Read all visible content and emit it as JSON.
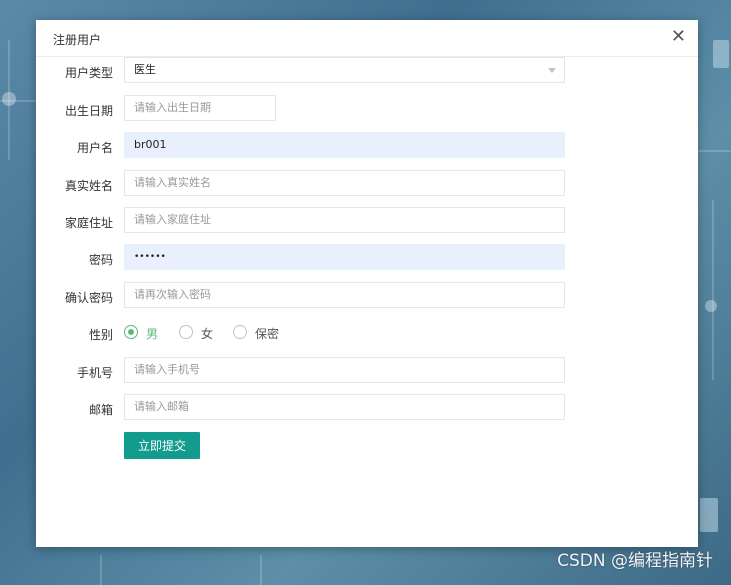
{
  "dialog": {
    "title": "注册用户",
    "close_glyph": "✕"
  },
  "form": {
    "user_type": {
      "label": "用户类型",
      "value": "医生"
    },
    "birth_date": {
      "label": "出生日期",
      "placeholder": "请输入出生日期"
    },
    "username": {
      "label": "用户名",
      "value": "br001"
    },
    "real_name": {
      "label": "真实姓名",
      "placeholder": "请输入真实姓名"
    },
    "address": {
      "label": "家庭住址",
      "placeholder": "请输入家庭住址"
    },
    "password": {
      "label": "密码",
      "value": "••••••"
    },
    "confirm_password": {
      "label": "确认密码",
      "placeholder": "请再次输入密码"
    },
    "gender": {
      "label": "性别",
      "options": [
        "男",
        "女",
        "保密"
      ],
      "selected": "男"
    },
    "phone": {
      "label": "手机号",
      "placeholder": "请输入手机号"
    },
    "email": {
      "label": "邮箱",
      "placeholder": "请输入邮箱"
    },
    "submit_label": "立即提交"
  },
  "watermark": "CSDN @编程指南针",
  "colors": {
    "accent": "#129c8e",
    "radio_checked": "#5fb878",
    "autofill_bg": "#e8f0fe"
  }
}
